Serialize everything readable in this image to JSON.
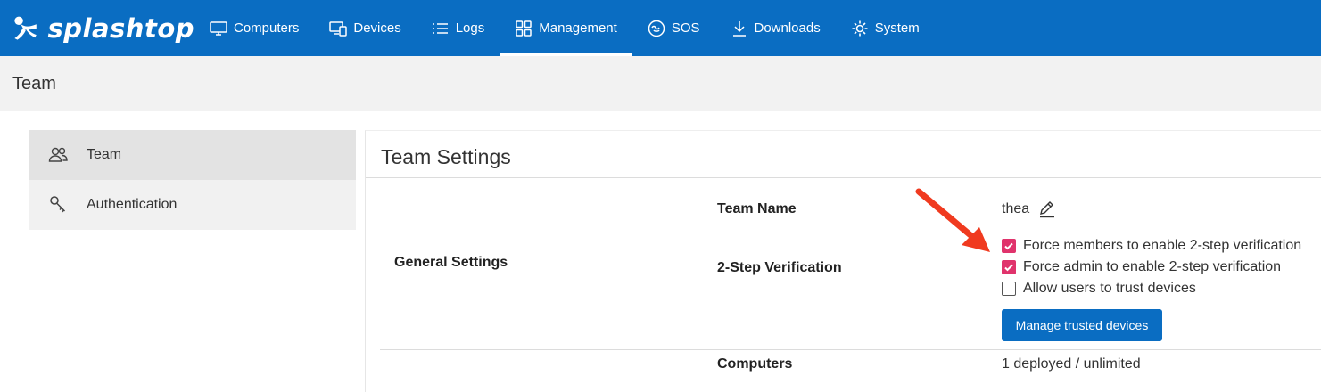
{
  "brand": {
    "name": "splashtop"
  },
  "nav": {
    "items": [
      {
        "label": "Computers",
        "icon": "monitor-icon"
      },
      {
        "label": "Devices",
        "icon": "devices-icon"
      },
      {
        "label": "Logs",
        "icon": "list-icon"
      },
      {
        "label": "Management",
        "icon": "grid-icon",
        "active": true
      },
      {
        "label": "SOS",
        "icon": "sos-icon"
      },
      {
        "label": "Downloads",
        "icon": "download-icon"
      },
      {
        "label": "System",
        "icon": "gear-icon"
      }
    ]
  },
  "page": {
    "title": "Team"
  },
  "sidebar": {
    "items": [
      {
        "label": "Team",
        "icon": "users-icon",
        "active": true
      },
      {
        "label": "Authentication",
        "icon": "key-icon"
      }
    ]
  },
  "panel": {
    "title": "Team Settings",
    "section": "General Settings",
    "team_name": {
      "label": "Team Name",
      "value": "thea"
    },
    "two_step": {
      "label": "2-Step Verification",
      "options": [
        {
          "label": "Force members to enable 2-step verification",
          "checked": true
        },
        {
          "label": "Force admin to enable 2-step verification",
          "checked": true
        },
        {
          "label": "Allow users to trust devices",
          "checked": false
        }
      ],
      "button": "Manage trusted devices"
    },
    "computers": {
      "label": "Computers",
      "value": "1 deployed / unlimited"
    }
  },
  "colors": {
    "primary": "#0a6dc2",
    "check": "#e0336c",
    "arrow": "#f03a1f"
  }
}
